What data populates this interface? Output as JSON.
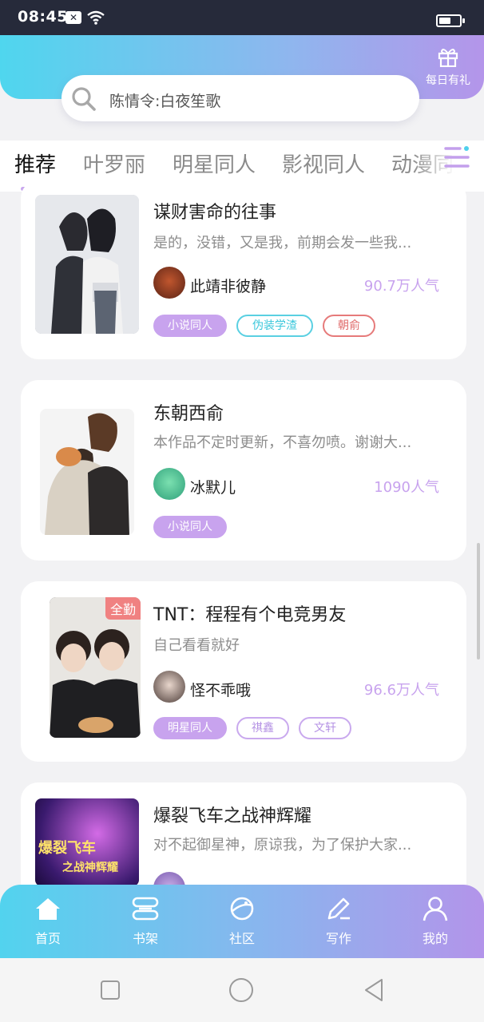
{
  "status_bar": {
    "time": "08:45"
  },
  "header": {
    "gift_label": "每日有礼"
  },
  "search": {
    "placeholder": "陈情令:白夜笙歌"
  },
  "tabs": [
    {
      "label": "推荐",
      "active": true
    },
    {
      "label": "叶罗丽"
    },
    {
      "label": "明星同人"
    },
    {
      "label": "影视同人"
    },
    {
      "label": "动漫同人"
    }
  ],
  "cards": [
    {
      "title": "谋财害命的往事",
      "desc": "是的，没错，又是我，前期会发一些我...",
      "author": "此靖非彼静",
      "popularity": "90.7万人气",
      "tags": [
        "小说同人",
        "伪装学渣",
        "朝俞"
      ]
    },
    {
      "title": "东朝西俞",
      "desc": "本作品不定时更新，不喜勿喷。谢谢大...",
      "author": "冰默儿",
      "popularity": "1090人气",
      "tags": [
        "小说同人"
      ]
    },
    {
      "title": "TNT：程程有个电竞男友",
      "desc": "自己看看就好",
      "author": "怪不乖哦",
      "popularity": "96.6万人气",
      "badge": "全勤",
      "tags": [
        "明星同人",
        "祺鑫",
        "文轩"
      ]
    },
    {
      "title": "爆裂飞车之战神辉耀",
      "desc": "对不起御星神，原谅我，为了保护大家...",
      "cover_text": [
        "爆裂飞车",
        "之战神辉耀"
      ]
    }
  ],
  "bottom_nav": [
    {
      "label": "首页",
      "icon": "home-icon",
      "active": true
    },
    {
      "label": "书架",
      "icon": "bookshelf-icon"
    },
    {
      "label": "社区",
      "icon": "planet-icon"
    },
    {
      "label": "写作",
      "icon": "pen-icon"
    },
    {
      "label": "我的",
      "icon": "person-icon"
    }
  ],
  "colors": {
    "accent": "#c8a3ee",
    "header_start": "#4fd6ee",
    "header_end": "#b495ea",
    "tag_teal": "#3cc8dc",
    "tag_red": "#e06a6a"
  }
}
